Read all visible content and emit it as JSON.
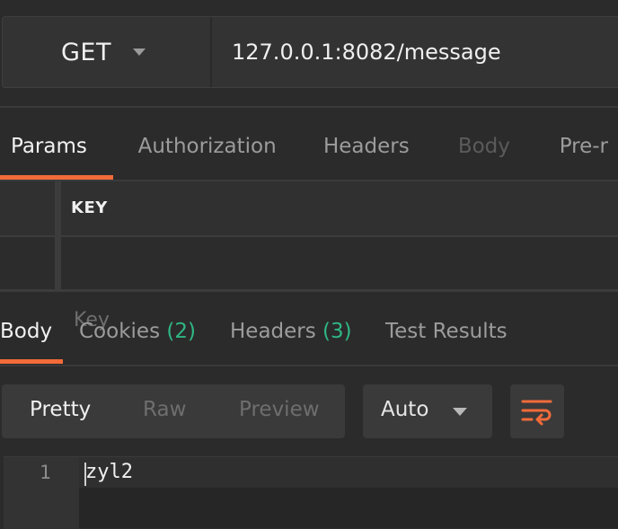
{
  "request": {
    "method": "GET",
    "url": "127.0.0.1:8082/message"
  },
  "request_tabs": [
    {
      "label": "Params",
      "active": true
    },
    {
      "label": "Authorization",
      "active": false
    },
    {
      "label": "Headers",
      "active": false
    },
    {
      "label": "Body",
      "active": false,
      "disabled": true
    },
    {
      "label": "Pre-r",
      "active": false
    }
  ],
  "params_table": {
    "header_key": "KEY",
    "key_placeholder": "Key"
  },
  "response_tabs": [
    {
      "label": "Body",
      "active": true
    },
    {
      "label": "Cookies",
      "count": "(2)"
    },
    {
      "label": "Headers",
      "count": "(3)"
    },
    {
      "label": "Test Results"
    }
  ],
  "view_toggle": {
    "options": [
      "Pretty",
      "Raw",
      "Preview"
    ],
    "selected": "Pretty"
  },
  "format_select": {
    "value": "Auto",
    "icon": "chevron-down-icon"
  },
  "wrap_button": {
    "icon": "wrap-lines-icon",
    "color": "#f26b3a"
  },
  "response_body": {
    "lines": [
      {
        "number": "1",
        "text": "zyl2"
      }
    ]
  },
  "colors": {
    "accent": "#f26b3a",
    "count": "#2fb784",
    "background": "#2b2b2b"
  }
}
